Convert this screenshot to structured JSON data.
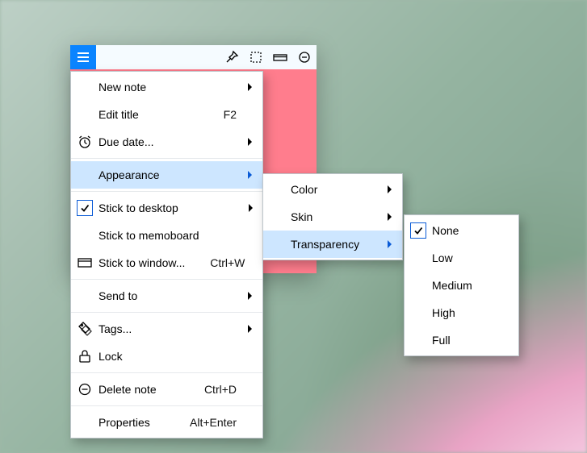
{
  "menu1": {
    "new_note": "New note",
    "edit_title": "Edit title",
    "edit_title_key": "F2",
    "due_date": "Due date...",
    "appearance": "Appearance",
    "stick_desktop": "Stick to desktop",
    "stick_memoboard": "Stick to memoboard",
    "stick_window": "Stick to window...",
    "stick_window_key": "Ctrl+W",
    "send_to": "Send to",
    "tags": "Tags...",
    "lock": "Lock",
    "delete": "Delete note",
    "delete_key": "Ctrl+D",
    "properties": "Properties",
    "properties_key": "Alt+Enter"
  },
  "menu2": {
    "color": "Color",
    "skin": "Skin",
    "transparency": "Transparency"
  },
  "menu3": {
    "none": "None",
    "low": "Low",
    "medium": "Medium",
    "high": "High",
    "full": "Full"
  }
}
